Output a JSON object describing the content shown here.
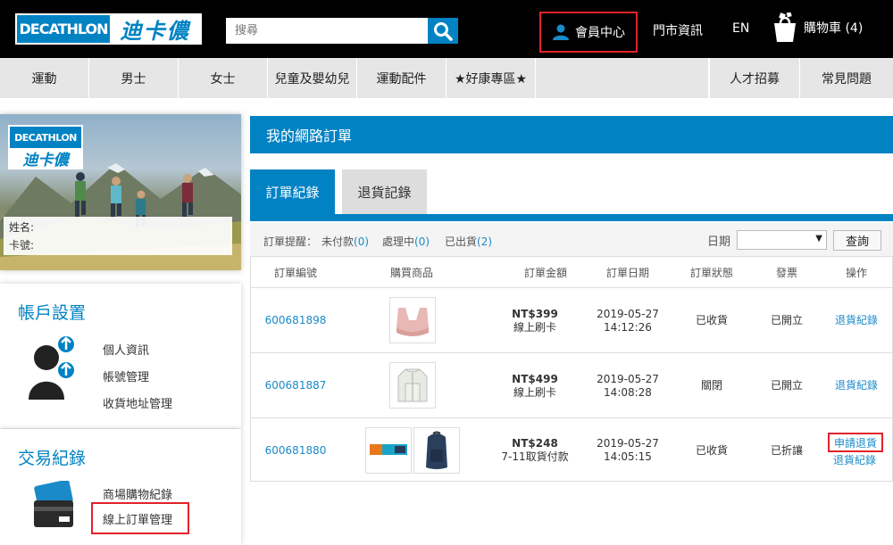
{
  "header": {
    "logo_en": "DECATHLON",
    "logo_zh": "迪卡儂",
    "search_placeholder": "搜尋",
    "member_center": "會員中心",
    "stores": "門市資訊",
    "lang": "EN",
    "cart": "購物車 (4)"
  },
  "nav": {
    "items": [
      "運動",
      "男士",
      "女士",
      "兒童及嬰幼兒",
      "運動配件",
      "★好康專區★"
    ],
    "right_items": [
      "人才招募",
      "常見問題"
    ]
  },
  "profile": {
    "logo_en": "DECATHLON",
    "logo_zh": "迪卡儂",
    "name_label": "姓名:",
    "card_label": "卡號:"
  },
  "account": {
    "title": "帳戶設置",
    "links": [
      "個人資訊",
      "帳號管理",
      "收貨地址管理"
    ]
  },
  "transactions": {
    "title": "交易紀錄",
    "links": [
      "商場購物紀錄",
      "線上訂單管理"
    ]
  },
  "main": {
    "title": "我的網路訂單",
    "tabs": [
      "訂單紀錄",
      "退貨記錄"
    ],
    "filter": {
      "reminder_label": "訂單提醒：",
      "unpaid": "未付款",
      "unpaid_count": "(0)",
      "processing": "處理中",
      "processing_count": "(0)",
      "shipped": "已出貨",
      "shipped_count": "(2)",
      "date_label": "日期",
      "query_button": "查詢"
    },
    "columns": [
      "訂單編號",
      "購買商品",
      "訂單金額",
      "訂單日期",
      "訂單狀態",
      "發票",
      "操作"
    ],
    "orders": [
      {
        "id": "600681898",
        "amount": "NT$399",
        "payment": "線上刷卡",
        "date": "2019-05-27",
        "time": "14:12:26",
        "status": "已收貨",
        "invoice": "已開立",
        "actions": [
          "退貨紀錄"
        ]
      },
      {
        "id": "600681887",
        "amount": "NT$499",
        "payment": "線上刷卡",
        "date": "2019-05-27",
        "time": "14:08:28",
        "status": "關閉",
        "invoice": "已開立",
        "actions": [
          "退貨紀錄"
        ]
      },
      {
        "id": "600681880",
        "amount": "NT$248",
        "payment": "7-11取貨付款",
        "date": "2019-05-27",
        "time": "14:05:15",
        "status": "已收貨",
        "invoice": "已折讓",
        "actions": [
          "申請退貨",
          "退貨紀錄"
        ]
      }
    ]
  },
  "colors": {
    "brand": "#0082c3",
    "highlight": "#e0232a"
  }
}
